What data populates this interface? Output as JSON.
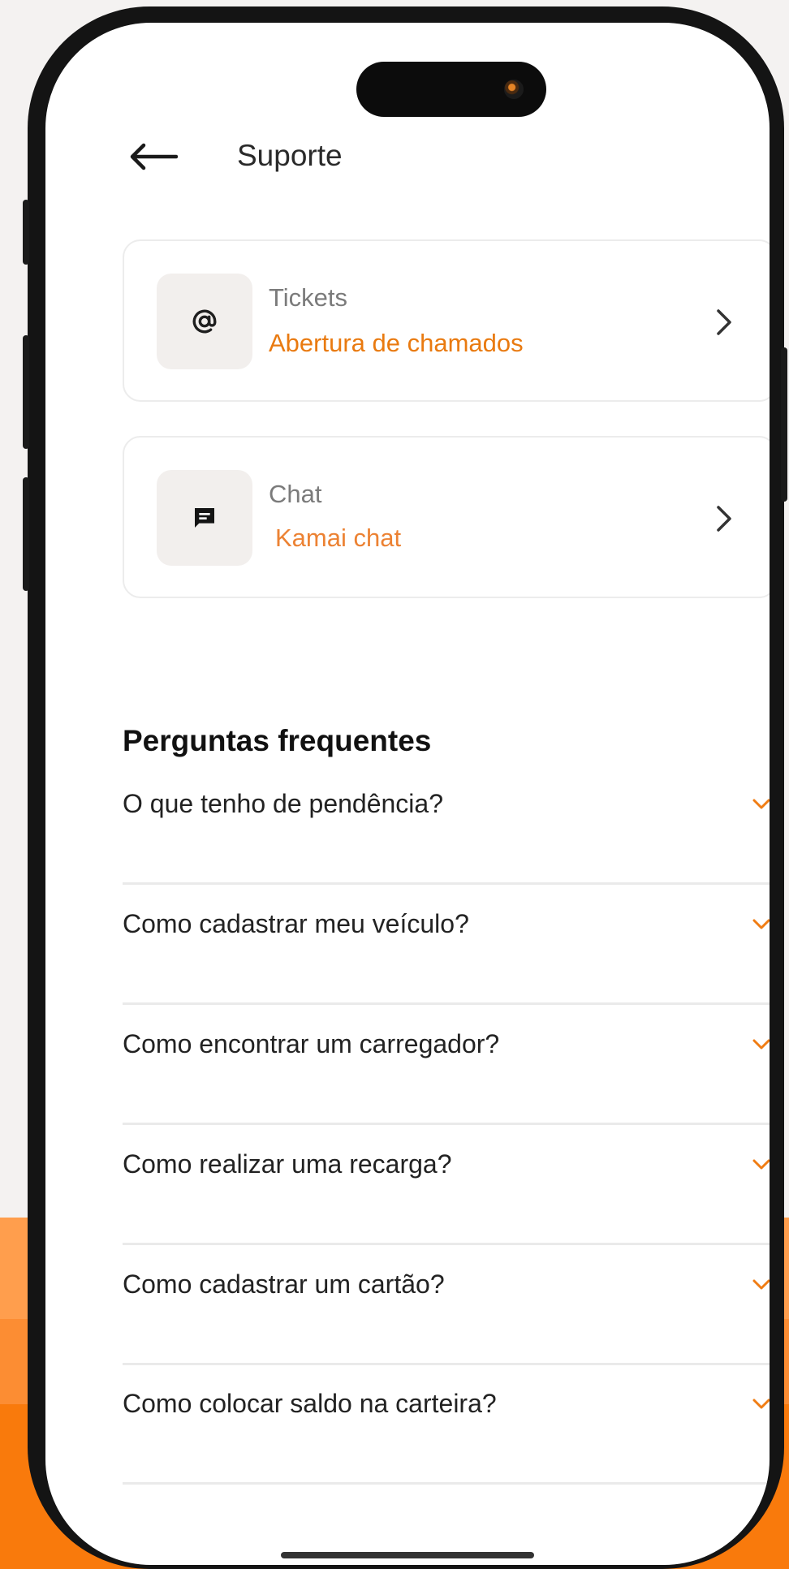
{
  "header": {
    "title": "Suporte",
    "back_icon": "arrow-left-icon"
  },
  "cards": [
    {
      "label": "Tickets",
      "subtitle": "Abertura de chamados",
      "icon": "at-icon"
    },
    {
      "label": "Chat",
      "subtitle": "Kamai chat",
      "icon": "chat-bubble-icon"
    }
  ],
  "faq": {
    "title": "Perguntas frequentes",
    "items": [
      "O que tenho de pendência?",
      "Como cadastrar meu veículo?",
      "Como encontrar um carregador?",
      "Como realizar uma recarga?",
      "Como cadastrar um cartão?",
      "Como colocar saldo na carteira?"
    ]
  },
  "colors": {
    "accent": "#e97a10",
    "orange_band": "#f97a0c",
    "card_icon_bg": "#f2efed"
  }
}
